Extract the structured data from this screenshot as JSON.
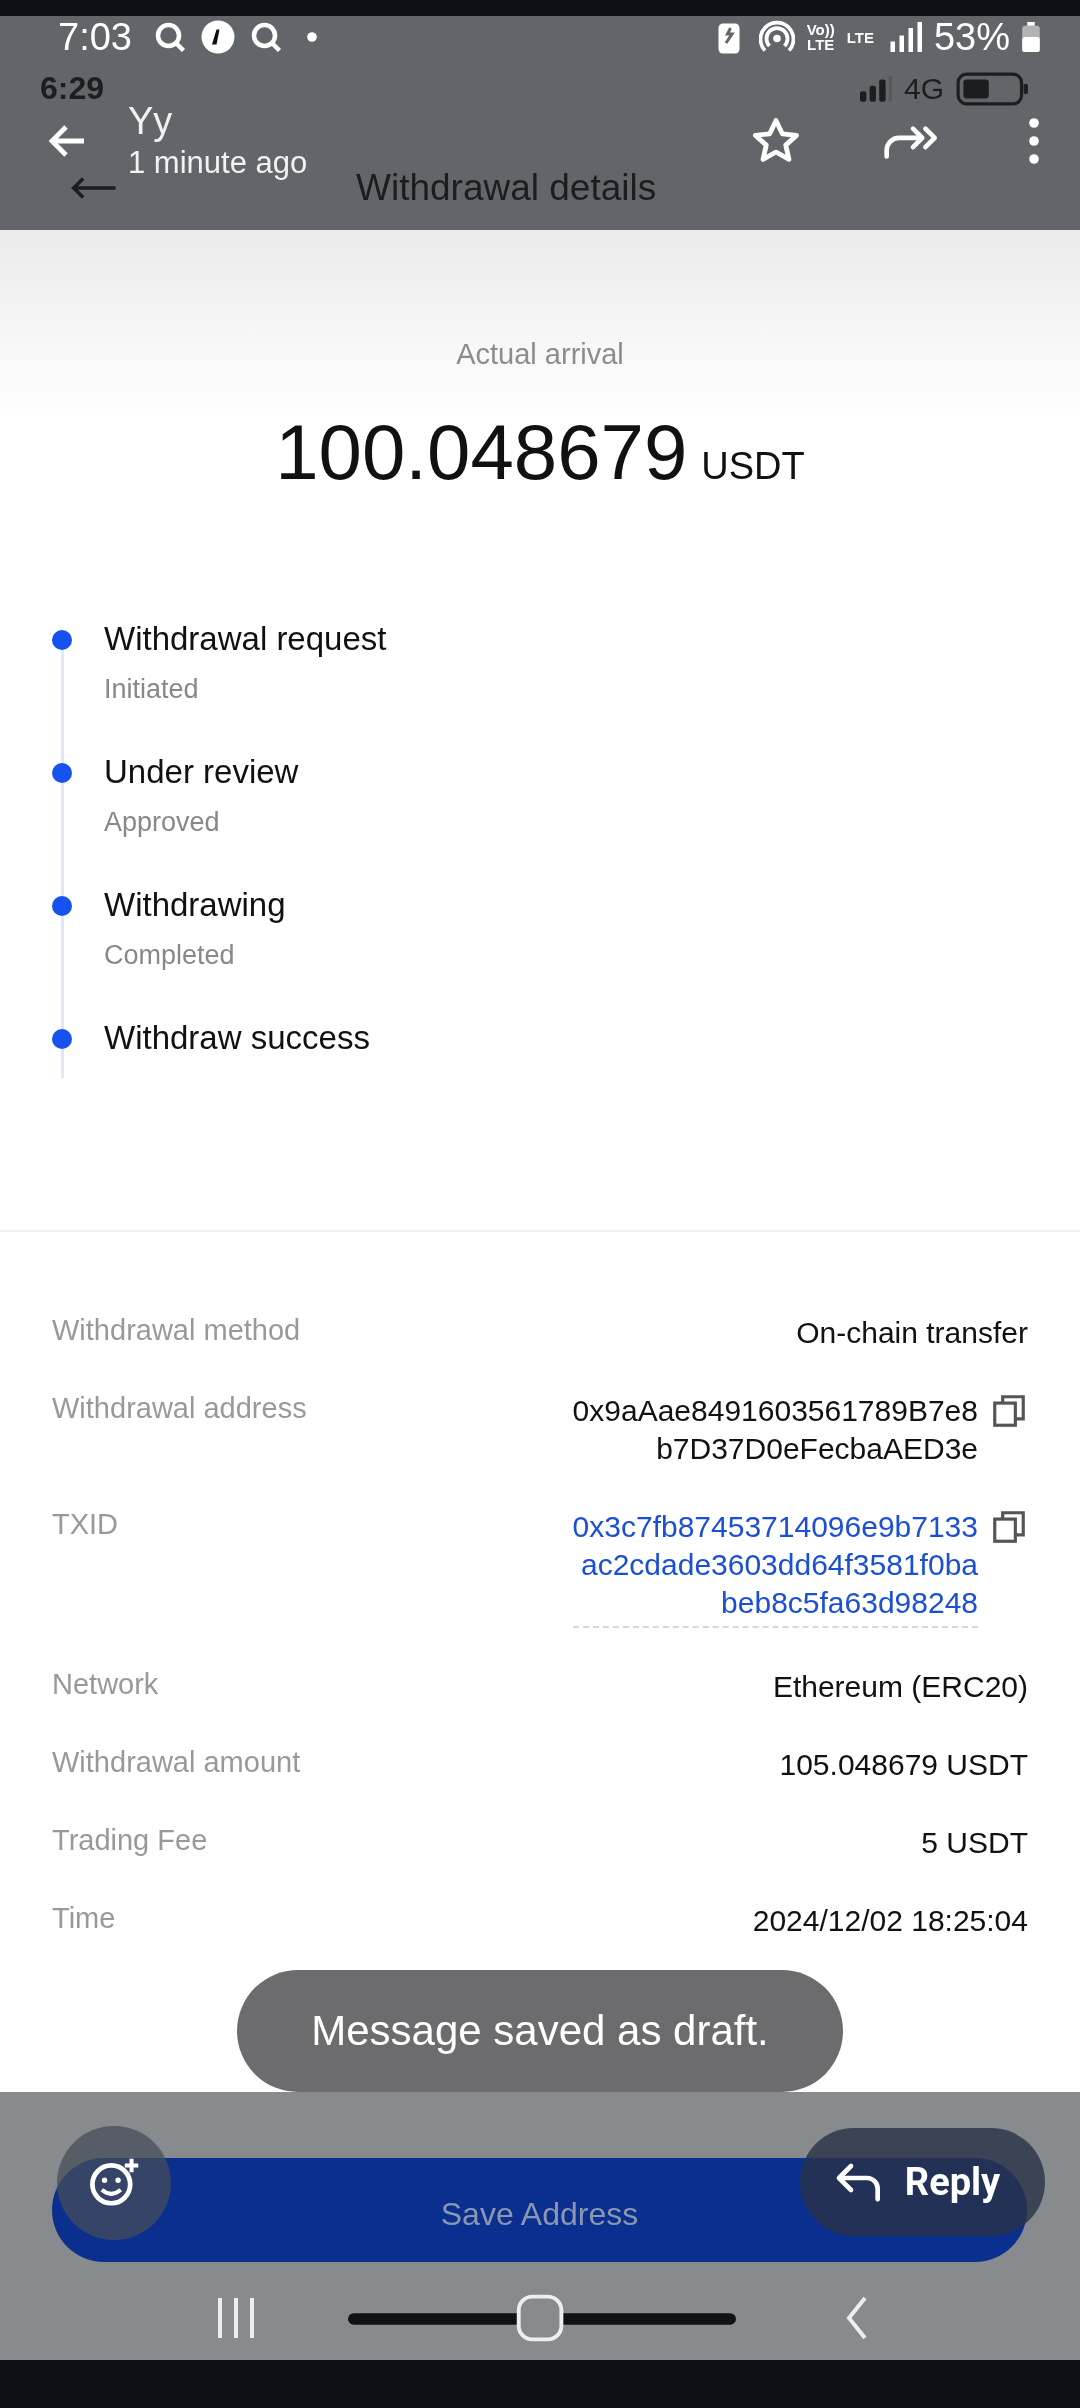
{
  "status_bar": {
    "time": "7:03",
    "indicators": [
      "Vo))",
      "LTE",
      "LTE"
    ],
    "battery": "53%"
  },
  "inner_status": {
    "time": "6:29",
    "network": "4G"
  },
  "viewer": {
    "sender": "Yy",
    "time": "1 minute ago"
  },
  "page": {
    "title": "Withdrawal details"
  },
  "arrival": {
    "label": "Actual arrival",
    "amount": "100.048679",
    "currency": "USDT"
  },
  "steps": [
    {
      "title": "Withdrawal request",
      "status": "Initiated"
    },
    {
      "title": "Under review",
      "status": "Approved"
    },
    {
      "title": "Withdrawing",
      "status": "Completed"
    },
    {
      "title": "Withdraw success"
    }
  ],
  "details": [
    {
      "kind": "text",
      "label": "Withdrawal method",
      "lines": [
        "On-chain transfer"
      ],
      "copyable": false
    },
    {
      "kind": "text",
      "label": "Withdrawal address",
      "lines": [
        "0x9aAae8491603561789B7e8",
        "b7D37D0eFecbaAED3e"
      ],
      "copyable": true
    },
    {
      "kind": "link",
      "label": "TXID",
      "lines": [
        "0x3c7fb87453714096e9b7133",
        "ac2cdade3603dd64f3581f0ba",
        "beb8c5fa63d98248"
      ],
      "copyable": true
    },
    {
      "kind": "text",
      "label": "Network",
      "lines": [
        "Ethereum (ERC20)"
      ],
      "copyable": false
    },
    {
      "kind": "text",
      "label": "Withdrawal amount",
      "lines": [
        "105.048679 USDT"
      ],
      "copyable": false
    },
    {
      "kind": "text",
      "label": "Trading Fee",
      "lines": [
        "5 USDT"
      ],
      "copyable": false
    },
    {
      "kind": "text",
      "label": "Time",
      "lines": [
        "2024/12/02 18:25:04"
      ],
      "copyable": false
    }
  ],
  "toast": "Message saved as draft.",
  "save_button": "Save Address",
  "reply_button": "Reply"
}
